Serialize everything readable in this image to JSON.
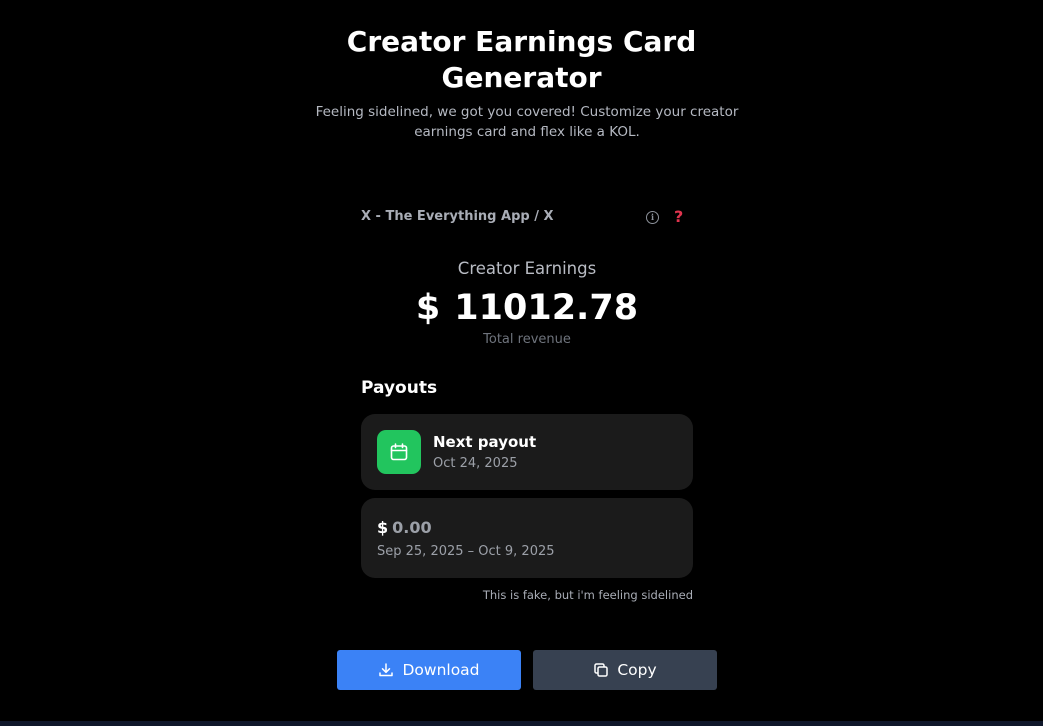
{
  "header": {
    "title_line1": "Creator Earnings Card",
    "title_line2": "Generator",
    "subtitle": "Feeling sidelined, we got you covered! Customize your creator earnings card and flex like a KOL."
  },
  "card": {
    "app_name": "X - The Everything App / X",
    "info_icon": "info-icon",
    "help_icon": "red-question-mark-icon",
    "earnings_label": "Creator Earnings",
    "currency": "$",
    "amount": "11012.78",
    "total_label": "Total revenue",
    "payouts_title": "Payouts",
    "next_payout": {
      "icon": "calendar-icon",
      "title": "Next payout",
      "date": "Oct 24, 2025"
    },
    "balance": {
      "currency": "$",
      "value": "0.00",
      "range": "Sep 25, 2025 – Oct 9, 2025"
    },
    "disclaimer": "This is fake, but i'm feeling sidelined"
  },
  "actions": {
    "download_label": "Download",
    "copy_label": "Copy"
  },
  "colors": {
    "background": "#000000",
    "card_bg": "#1b1b1b",
    "accent_green": "#22c55e",
    "download_blue": "#3b82f6",
    "copy_gray": "#374151"
  }
}
